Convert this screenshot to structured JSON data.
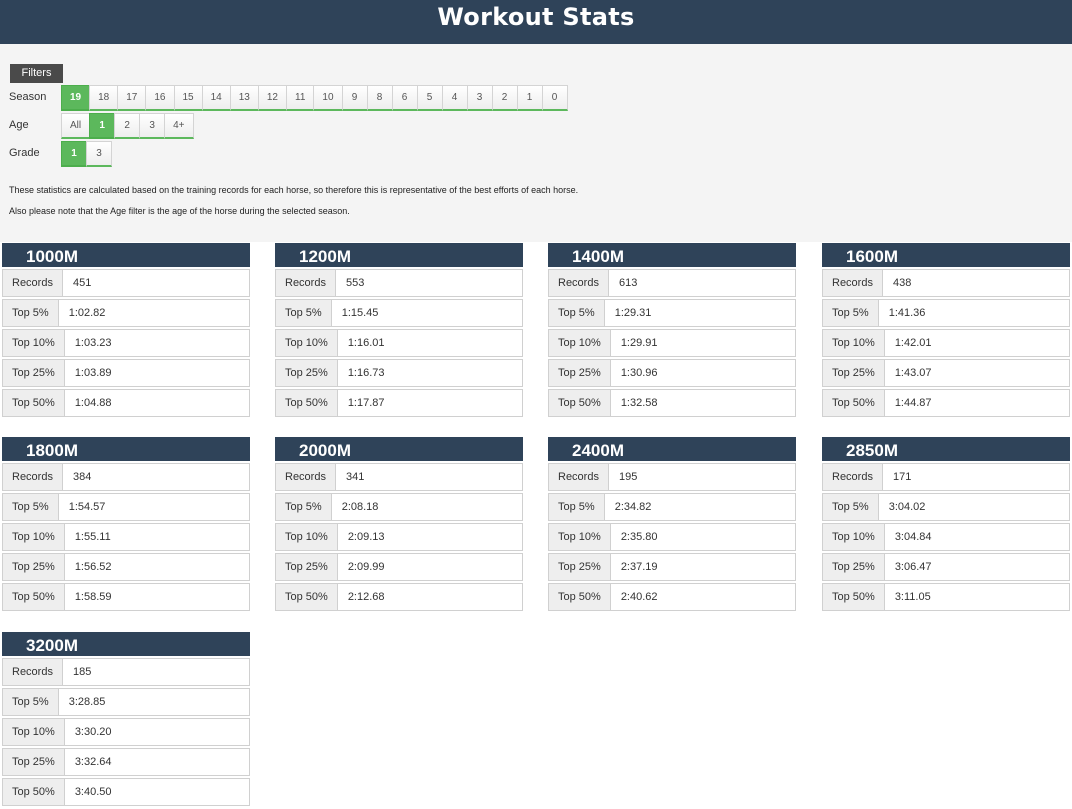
{
  "header": {
    "title": "Workout Stats"
  },
  "filters": {
    "label": "Filters",
    "season": {
      "label": "Season",
      "options": [
        "19",
        "18",
        "17",
        "16",
        "15",
        "14",
        "13",
        "12",
        "11",
        "10",
        "9",
        "8",
        "6",
        "5",
        "4",
        "3",
        "2",
        "1",
        "0"
      ],
      "selected": "19"
    },
    "age": {
      "label": "Age",
      "options": [
        "All",
        "1",
        "2",
        "3",
        "4+"
      ],
      "selected": "1"
    },
    "grade": {
      "label": "Grade",
      "options": [
        "1",
        "3"
      ],
      "selected": "1"
    }
  },
  "notes": [
    "These statistics are calculated based on the training records for each horse, so therefore this is representative of the best efforts of each horse.",
    "Also please note that the Age filter is the age of the horse during the selected season."
  ],
  "stat_labels": [
    "Records",
    "Top 5%",
    "Top 10%",
    "Top 25%",
    "Top 50%"
  ],
  "distances": [
    {
      "title": "1000M",
      "values": [
        "451",
        "1:02.82",
        "1:03.23",
        "1:03.89",
        "1:04.88"
      ]
    },
    {
      "title": "1200M",
      "values": [
        "553",
        "1:15.45",
        "1:16.01",
        "1:16.73",
        "1:17.87"
      ]
    },
    {
      "title": "1400M",
      "values": [
        "613",
        "1:29.31",
        "1:29.91",
        "1:30.96",
        "1:32.58"
      ]
    },
    {
      "title": "1600M",
      "values": [
        "438",
        "1:41.36",
        "1:42.01",
        "1:43.07",
        "1:44.87"
      ]
    },
    {
      "title": "1800M",
      "values": [
        "384",
        "1:54.57",
        "1:55.11",
        "1:56.52",
        "1:58.59"
      ]
    },
    {
      "title": "2000M",
      "values": [
        "341",
        "2:08.18",
        "2:09.13",
        "2:09.99",
        "2:12.68"
      ]
    },
    {
      "title": "2400M",
      "values": [
        "195",
        "2:34.82",
        "2:35.80",
        "2:37.19",
        "2:40.62"
      ]
    },
    {
      "title": "2850M",
      "values": [
        "171",
        "3:04.02",
        "3:04.84",
        "3:06.47",
        "3:11.05"
      ]
    },
    {
      "title": "3200M",
      "values": [
        "185",
        "3:28.85",
        "3:30.20",
        "3:32.64",
        "3:40.50"
      ]
    }
  ],
  "colors": {
    "header": "#2f4359",
    "active": "#5cb85c",
    "panel": "#f4f4f4"
  }
}
